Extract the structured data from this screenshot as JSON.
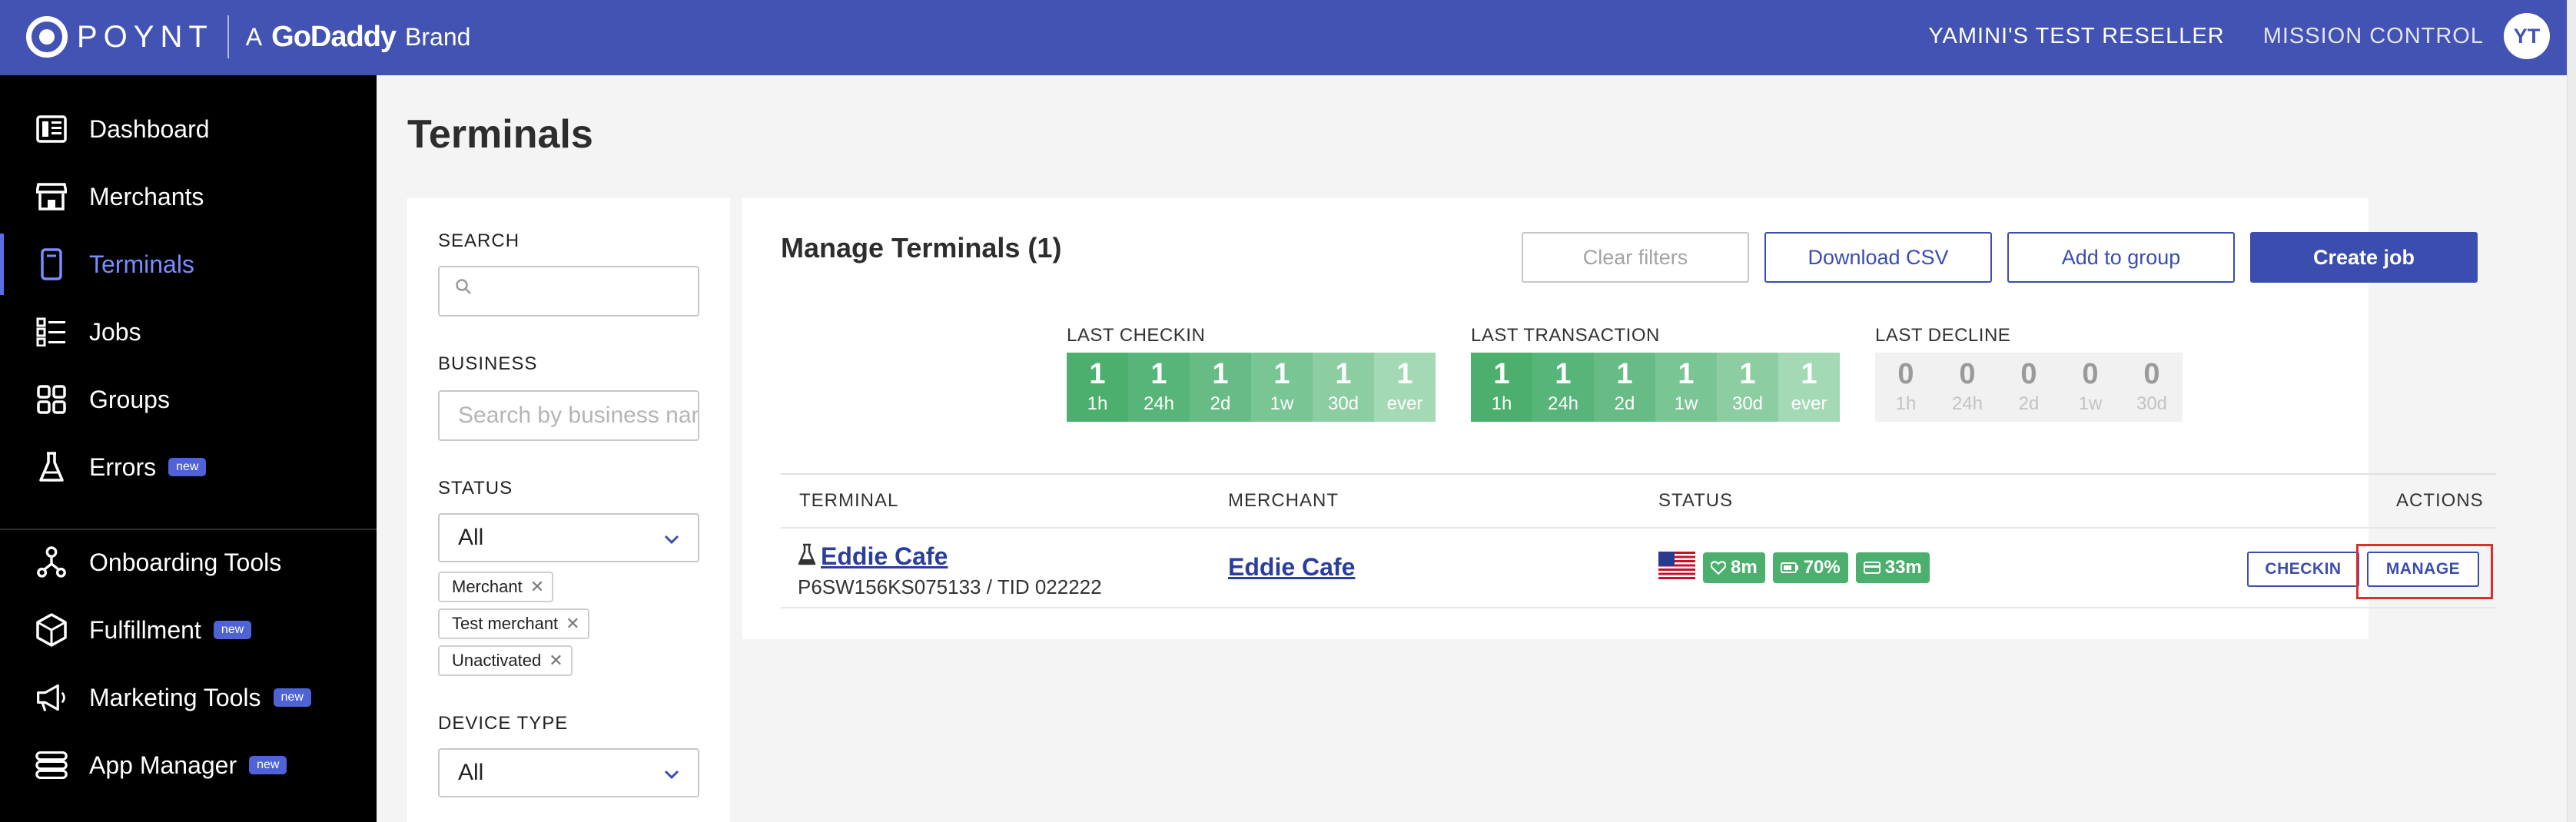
{
  "header": {
    "logo_text": "POYNT",
    "brand_prefix": "A",
    "brand_name": "GoDaddy",
    "brand_suffix": "Brand",
    "account": "YAMINI'S TEST RESELLER",
    "mission_control": "MISSION CONTROL",
    "avatar_initials": "YT"
  },
  "sidebar": {
    "items": [
      {
        "label": "Dashboard",
        "icon": "dashboard-icon"
      },
      {
        "label": "Merchants",
        "icon": "store-icon"
      },
      {
        "label": "Terminals",
        "icon": "terminal-icon",
        "active": true
      },
      {
        "label": "Jobs",
        "icon": "checklist-icon"
      },
      {
        "label": "Groups",
        "icon": "grid-icon"
      },
      {
        "label": "Errors",
        "icon": "flask-icon",
        "badge": "new"
      },
      {
        "label": "Onboarding Tools",
        "icon": "onboarding-icon"
      },
      {
        "label": "Fulfillment",
        "icon": "package-icon",
        "badge": "new"
      },
      {
        "label": "Marketing Tools",
        "icon": "megaphone-icon",
        "badge": "new"
      },
      {
        "label": "App Manager",
        "icon": "app-manager-icon",
        "badge": "new"
      }
    ]
  },
  "page": {
    "title": "Terminals"
  },
  "filters": {
    "search_label": "SEARCH",
    "search_value": "",
    "business_label": "BUSINESS",
    "business_placeholder": "Search by business name",
    "status_label": "STATUS",
    "status_value": "All",
    "status_chips": [
      "Merchant",
      "Test merchant",
      "Unactivated"
    ],
    "device_type_label": "DEVICE TYPE",
    "device_type_value": "All"
  },
  "panel": {
    "title": "Manage Terminals (1)",
    "buttons": {
      "clear_filters": "Clear filters",
      "download_csv": "Download CSV",
      "add_to_group": "Add to group",
      "create_job": "Create job"
    },
    "metrics": [
      {
        "label": "LAST CHECKIN",
        "style": "green",
        "cells": [
          {
            "v": "1",
            "p": "1h"
          },
          {
            "v": "1",
            "p": "24h"
          },
          {
            "v": "1",
            "p": "2d"
          },
          {
            "v": "1",
            "p": "1w"
          },
          {
            "v": "1",
            "p": "30d"
          },
          {
            "v": "1",
            "p": "ever"
          }
        ]
      },
      {
        "label": "LAST TRANSACTION",
        "style": "green",
        "cells": [
          {
            "v": "1",
            "p": "1h"
          },
          {
            "v": "1",
            "p": "24h"
          },
          {
            "v": "1",
            "p": "2d"
          },
          {
            "v": "1",
            "p": "1w"
          },
          {
            "v": "1",
            "p": "30d"
          },
          {
            "v": "1",
            "p": "ever"
          }
        ]
      },
      {
        "label": "LAST DECLINE",
        "style": "grey",
        "cells": [
          {
            "v": "0",
            "p": "1h"
          },
          {
            "v": "0",
            "p": "24h"
          },
          {
            "v": "0",
            "p": "2d"
          },
          {
            "v": "0",
            "p": "1w"
          },
          {
            "v": "0",
            "p": "30d"
          }
        ]
      }
    ],
    "green_shades": [
      "#4caf6d",
      "#58b579",
      "#66bc84",
      "#79c593",
      "#8ccea2",
      "#a3d9b4"
    ],
    "table": {
      "columns": {
        "terminal": "TERMINAL",
        "merchant": "MERCHANT",
        "status": "STATUS",
        "actions": "ACTIONS"
      },
      "row": {
        "terminal_name": "Eddie Cafe",
        "terminal_sub": "P6SW156KS075133 / TID 022222",
        "merchant": "Eddie Cafe",
        "heartbeat": "8m",
        "battery": "70%",
        "last_txn": "33m",
        "checkin_button": "CHECKIN",
        "manage_button": "MANAGE"
      }
    }
  },
  "colors": {
    "brand": "#4353b3",
    "accent": "#3b4dae",
    "status_green": "#4caf6d",
    "highlight": "#d63030"
  }
}
